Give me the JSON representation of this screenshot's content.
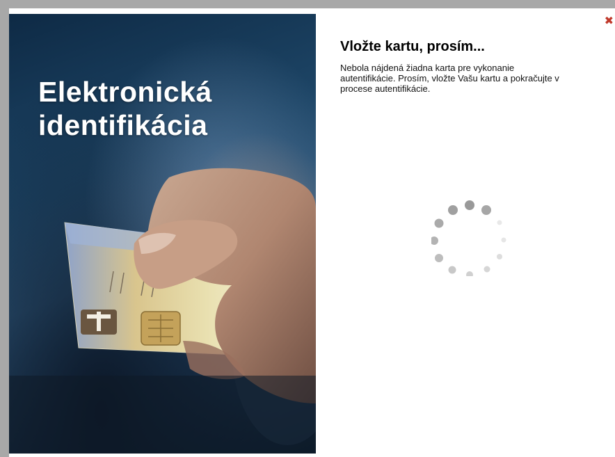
{
  "hero": {
    "title_line1": "Elektronická",
    "title_line2": "identifikácia",
    "image": "hand-holding-id-card"
  },
  "dialog": {
    "heading": "Vložte kartu, prosím...",
    "message": "Nebola nájdená žiadna karta pre vykonanie autentifikácie. Prosím, vložte Vašu kartu a pokračujte v procese autentifikácie.",
    "close_icon": "close-icon",
    "close_symbol": "✖"
  },
  "spinner": {
    "icon": "loading-spinner-icon"
  },
  "colors": {
    "close": "#c0392b",
    "frame": "#a8a8a8",
    "spinner": "#9a9a9a"
  }
}
